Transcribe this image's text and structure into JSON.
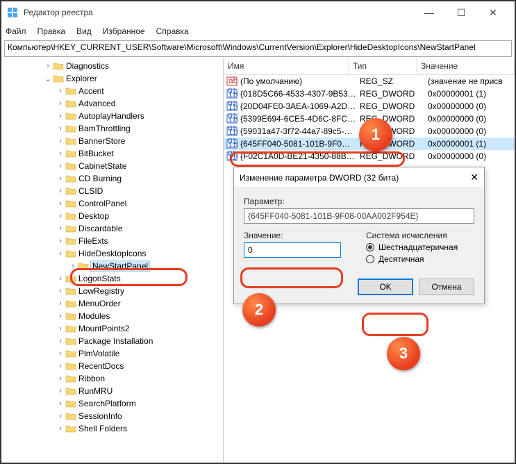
{
  "window": {
    "title": "Редактор реестра",
    "min": "—",
    "max": "☐",
    "close": "✕"
  },
  "menu": {
    "file": "Файл",
    "edit": "Правка",
    "view": "Вид",
    "fav": "Избранное",
    "help": "Справка"
  },
  "address": "Компьютер\\HKEY_CURRENT_USER\\Software\\Microsoft\\Windows\\CurrentVersion\\Explorer\\HideDesktopIcons\\NewStartPanel",
  "tree": {
    "items": [
      {
        "ind": 60,
        "tw": "",
        "lbl": "Diagnostics"
      },
      {
        "ind": 60,
        "tw": "v",
        "lbl": "Explorer"
      },
      {
        "ind": 78,
        "tw": "",
        "lbl": "Accent"
      },
      {
        "ind": 78,
        "tw": "",
        "lbl": "Advanced"
      },
      {
        "ind": 78,
        "tw": "",
        "lbl": "AutoplayHandlers"
      },
      {
        "ind": 78,
        "tw": "",
        "lbl": "BamThrottling"
      },
      {
        "ind": 78,
        "tw": "",
        "lbl": "BannerStore"
      },
      {
        "ind": 78,
        "tw": "",
        "lbl": "BitBucket"
      },
      {
        "ind": 78,
        "tw": "",
        "lbl": "CabinetState"
      },
      {
        "ind": 78,
        "tw": "",
        "lbl": "CD Burning"
      },
      {
        "ind": 78,
        "tw": "",
        "lbl": "CLSID"
      },
      {
        "ind": 78,
        "tw": "",
        "lbl": "ControlPanel"
      },
      {
        "ind": 78,
        "tw": "",
        "lbl": "Desktop"
      },
      {
        "ind": 78,
        "tw": "",
        "lbl": "Discardable"
      },
      {
        "ind": 78,
        "tw": "",
        "lbl": "FileExts"
      },
      {
        "ind": 78,
        "tw": "",
        "lbl": "HideDesktopIcons"
      },
      {
        "ind": 96,
        "tw": "",
        "lbl": "NewStartPanel",
        "sel": true
      },
      {
        "ind": 78,
        "tw": "",
        "lbl": "LogonStats"
      },
      {
        "ind": 78,
        "tw": "",
        "lbl": "LowRegistry"
      },
      {
        "ind": 78,
        "tw": "",
        "lbl": "MenuOrder"
      },
      {
        "ind": 78,
        "tw": "",
        "lbl": "Modules"
      },
      {
        "ind": 78,
        "tw": "",
        "lbl": "MountPoints2"
      },
      {
        "ind": 78,
        "tw": "",
        "lbl": "Package Installation"
      },
      {
        "ind": 78,
        "tw": "",
        "lbl": "PlmVolatile"
      },
      {
        "ind": 78,
        "tw": "",
        "lbl": "RecentDocs"
      },
      {
        "ind": 78,
        "tw": "",
        "lbl": "Ribbon"
      },
      {
        "ind": 78,
        "tw": "",
        "lbl": "RunMRU"
      },
      {
        "ind": 78,
        "tw": "",
        "lbl": "SearchPlatform"
      },
      {
        "ind": 78,
        "tw": "",
        "lbl": "SessionInfo"
      },
      {
        "ind": 78,
        "tw": "",
        "lbl": "Shell Folders"
      }
    ]
  },
  "cols": {
    "name": "Имя",
    "type": "Тип",
    "value": "Значение"
  },
  "rows": [
    {
      "icon": "str",
      "name": "(По умолчанию)",
      "type": "REG_SZ",
      "val": "(значение не присв"
    },
    {
      "icon": "bin",
      "name": "{018D5C66-4533-4307-9B53…",
      "type": "REG_DWORD",
      "val": "0x00000001 (1)"
    },
    {
      "icon": "bin",
      "name": "{20D04FE0-3AEA-1069-A2D…",
      "type": "REG_DWORD",
      "val": "0x00000000 (0)"
    },
    {
      "icon": "bin",
      "name": "{5399E694-6CE5-4D6C-8FC…",
      "type": "REG_DWORD",
      "val": "0x00000000 (0)"
    },
    {
      "icon": "bin",
      "name": "{59031a47-3f72-44a7-89c5-…",
      "type": "REG_DWORD",
      "val": "0x00000000 (0)"
    },
    {
      "icon": "bin",
      "name": "{645FF040-5081-101B-9F0…",
      "type": "REG_DWORD",
      "val": "0x00000001 (1)",
      "sel": true
    },
    {
      "icon": "bin",
      "name": "{F02C1A0D-BE21-4350-88B…",
      "type": "REG_DWORD",
      "val": "0x00000000 (0)"
    }
  ],
  "dialog": {
    "title": "Изменение параметра DWORD (32 бита)",
    "param_label": "Параметр:",
    "param_value": "{645FF040-5081-101B-9F08-00AA002F954E}",
    "value_label": "Значение:",
    "value": "0",
    "base_label": "Система исчисления",
    "hex": "Шестнадцатеричная",
    "dec": "Десятичная",
    "ok": "OK",
    "cancel": "Отмена"
  },
  "badges": {
    "b1": "1",
    "b2": "2",
    "b3": "3"
  }
}
